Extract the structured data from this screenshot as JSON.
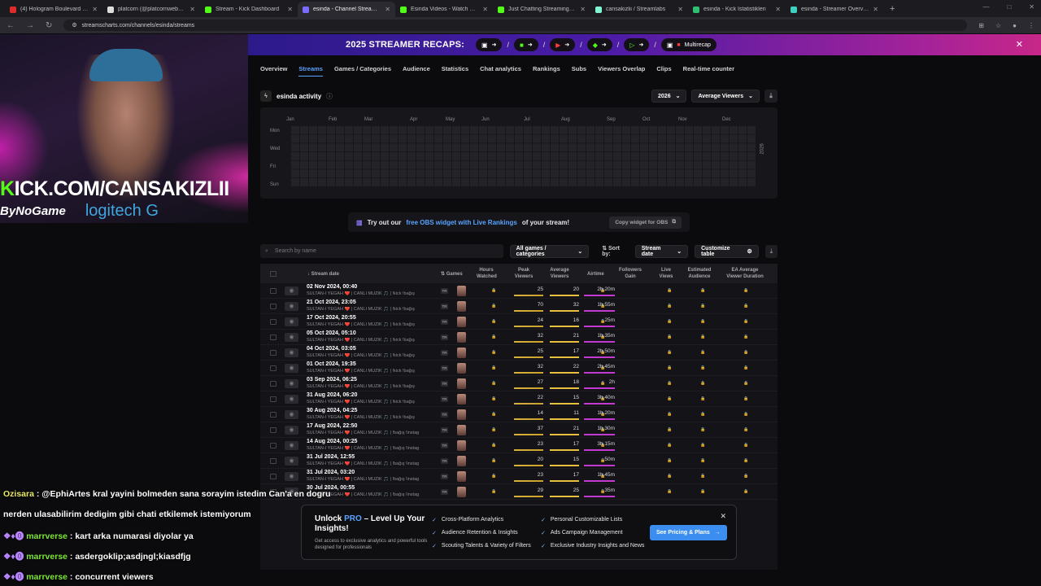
{
  "tabs": [
    {
      "title": "(4) Hologram Boulevard - Y",
      "color": "#e02b2b"
    },
    {
      "title": "platcorn (@platcornweb) / X",
      "color": "#dddddd"
    },
    {
      "title": "Stream - Kick Dashboard",
      "color": "#53fc18"
    },
    {
      "title": "esinda - Channel Streams on Tw",
      "color": "#7b6cff"
    },
    {
      "title": "Esinda Videos - Watch On-Dem",
      "color": "#53fc18"
    },
    {
      "title": "Just Chatting Streaming - Live",
      "color": "#53fc18"
    },
    {
      "title": "cansakizlii / Streamlabs",
      "color": "#80f5d2"
    },
    {
      "title": "esinda - Kick İstatistikleri",
      "color": "#2fbf71"
    },
    {
      "title": "esinda - Streamer Overview & S",
      "color": "#3fd0c0"
    }
  ],
  "url": "streamscharts.com/channels/esinda/streams",
  "banner": {
    "title": "2025 STREAMER RECAPS:",
    "pills": [
      "",
      "",
      "",
      "",
      ""
    ],
    "last_pill": "Multirecap"
  },
  "subnav": [
    "Overview",
    "Streams",
    "Games / Categories",
    "Audience",
    "Statistics",
    "Chat analytics",
    "Rankings",
    "Subs",
    "Viewers Overlap",
    "Clips",
    "Real-time counter"
  ],
  "activity": {
    "title": "esinda activity",
    "year": "2026",
    "metric": "Average Viewers",
    "months": [
      "Jan",
      "Feb",
      "Mar",
      "Apr",
      "May",
      "Jun",
      "Jul",
      "Aug",
      "Sep",
      "Oct",
      "Nov",
      "Dec"
    ],
    "days": [
      "Mon",
      "Wed",
      "Fri",
      "Sun"
    ],
    "side_year": "2026"
  },
  "obs": {
    "pre": "Try out our",
    "link": "free OBS widget with Live Rankings",
    "post": "of your stream!",
    "button": "Copy widget for OBS"
  },
  "filters": {
    "search_placeholder": "Search by name",
    "games": "All games / categories",
    "sort_label": "Sort by:",
    "sort_value": "Stream date",
    "customize": "Customize table"
  },
  "columns": {
    "date": "Stream date",
    "games": "Games",
    "hours": "Hours Watched",
    "peak": "Peak Viewers",
    "avg": "Average Viewers",
    "airtime": "Airtime",
    "followers": "Followers Gain",
    "live": "Live Views",
    "est": "Estimated Audience",
    "ea": "EA Average Viewer Duration"
  },
  "rows": [
    {
      "date": "02 Nov 2024, 00:40",
      "title": "SULTAN-I YEGAH ❤️ | CANLI MÜZİK 🎵 | !kick !bağış",
      "peak": "25",
      "avg": "20",
      "air": "2h 20m"
    },
    {
      "date": "21 Oct 2024, 23:05",
      "title": "SULTAN-I YEGAH ❤️ | CANLI MÜZİK 🎵 | !kick !bağış",
      "peak": "70",
      "avg": "32",
      "air": "1h 55m"
    },
    {
      "date": "17 Oct 2024, 20:55",
      "title": "SULTAN-I YEGAH ❤️ | CANLI MÜZİK 🎵 | !kick !bağış",
      "peak": "24",
      "avg": "16",
      "air": "25m"
    },
    {
      "date": "05 Oct 2024, 05:10",
      "title": "SULTAN-I YEGAH ❤️ | CANLI MÜZİK 🎵 | !kick !bağış",
      "peak": "32",
      "avg": "21",
      "air": "1h 35m"
    },
    {
      "date": "04 Oct 2024, 03:05",
      "title": "SULTAN-I YEGAH ❤️ | CANLI MÜZİK 🎵 | !kick !bağış",
      "peak": "25",
      "avg": "17",
      "air": "2h 50m"
    },
    {
      "date": "01 Oct 2024, 19:35",
      "title": "SULTAN-I YEGAH ❤️ | CANLI MÜZİK 🎵 | !kick !bağış",
      "peak": "32",
      "avg": "22",
      "air": "2h 45m"
    },
    {
      "date": "03 Sep 2024, 06:25",
      "title": "SULTAN-I YEGAH ❤️ | CANLI MÜZİK 🎵 | !kick !bağış",
      "peak": "27",
      "avg": "18",
      "air": "2h"
    },
    {
      "date": "31 Aug 2024, 06:20",
      "title": "SULTAN-I YEGAH ❤️ | CANLI MÜZİK 🎵 | !kick !bağış",
      "peak": "22",
      "avg": "15",
      "air": "3h 40m"
    },
    {
      "date": "30 Aug 2024, 04:25",
      "title": "SULTAN-I YEGAH ❤️ | CANLI MÜZİK 🎵 | !kick !bağış",
      "peak": "14",
      "avg": "11",
      "air": "1h 20m"
    },
    {
      "date": "17 Aug 2024, 22:50",
      "title": "SULTAN-I YEGAH ❤️ | CANLI MÜZİK 🎵 | !bağış !instag",
      "peak": "37",
      "avg": "21",
      "air": "1h 30m"
    },
    {
      "date": "14 Aug 2024, 00:25",
      "title": "SULTAN-I YEGAH ❤️ | CANLI MÜZİK 🎵 | !bağış !instag",
      "peak": "23",
      "avg": "17",
      "air": "3h 15m"
    },
    {
      "date": "31 Jul 2024, 12:55",
      "title": "SULTAN-I YEGAH ❤️ | CANLI MÜZİK 🎵 | !bağış !instag",
      "peak": "20",
      "avg": "15",
      "air": "50m"
    },
    {
      "date": "31 Jul 2024, 03:20",
      "title": "SULTAN-I YEGAH ❤️ | CANLI MÜZİK 🎵 | !bağış !instag",
      "peak": "23",
      "avg": "17",
      "air": "1h 45m"
    },
    {
      "date": "30 Jul 2024, 00:55",
      "title": "SULTAN-I YEGAH ❤️ | CANLI MÜZİK 🎵 | !bağış !instag",
      "peak": "29",
      "avg": "25",
      "air": "35m"
    }
  ],
  "lang_tag": "TR",
  "pro": {
    "title_pre": "Unlock",
    "title_pro": "PRO",
    "title_post": "– Level Up Your Insights!",
    "desc": "Get access to exclusive analytics and powerful tools designed for professionals",
    "features": [
      "Cross-Platform Analytics",
      "Audience Retention & Insights",
      "Scouting Talents & Variety of Filters",
      "Personal Customizable Lists",
      "Ads Campaign Management",
      "Exclusive Industry Insights and News"
    ],
    "button": "See Pricing & Plans"
  },
  "overlay": {
    "kick_k": "K",
    "kick_rest": "ICK.COM/CANSAKIZLII",
    "sponsor1": "ByNoGame",
    "sponsor2": "logitech G"
  },
  "chat": [
    {
      "name": "Ozisara",
      "text": " : @EphiArtes kral yayini bolmeden sana sorayim istedim Can'a en dogru",
      "cls": "nm1"
    },
    {
      "name": "",
      "text": "nerden ulasabilirim dedigim gibi chati etkilemek istemiyorum",
      "cls": ""
    },
    {
      "name": "marrverse",
      "text": " : kart arka numarasi diyolar ya",
      "cls": "nm2"
    },
    {
      "name": "marrverse",
      "text": " : asdergoklip;asdjngl;kiasdfjg",
      "cls": "nm2"
    },
    {
      "name": "marrverse",
      "text": " : concurrent viewers",
      "cls": "nm2"
    }
  ]
}
